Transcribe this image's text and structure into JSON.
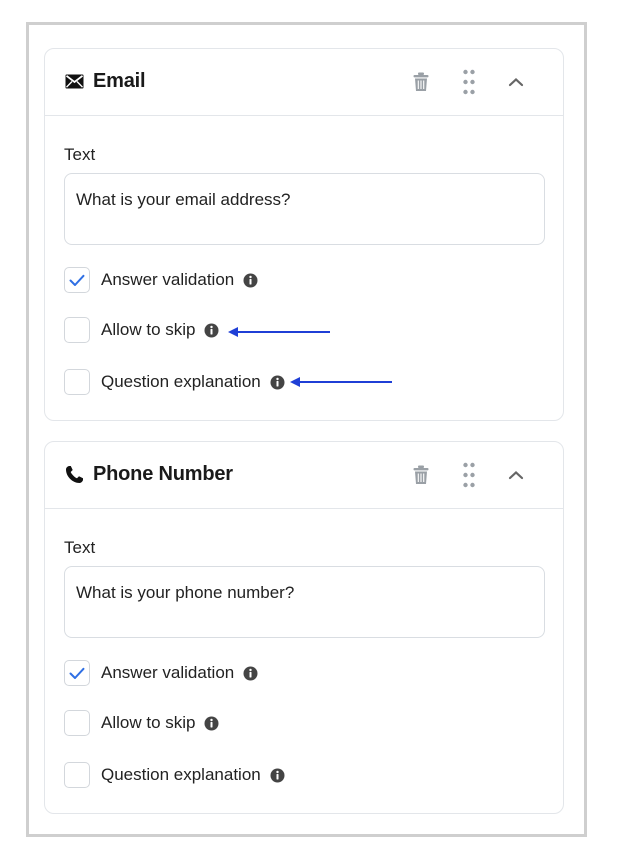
{
  "cards": [
    {
      "title": "Email",
      "icon": "envelope-icon",
      "field_label": "Text",
      "input_value": "What is your email address?",
      "options": [
        {
          "label": "Answer validation",
          "checked": true
        },
        {
          "label": "Allow to skip",
          "checked": false
        },
        {
          "label": "Question explanation",
          "checked": false
        }
      ]
    },
    {
      "title": "Phone Number",
      "icon": "phone-icon",
      "field_label": "Text",
      "input_value": "What is your phone number?",
      "options": [
        {
          "label": "Answer validation",
          "checked": true
        },
        {
          "label": "Allow to skip",
          "checked": false
        },
        {
          "label": "Question explanation",
          "checked": false
        }
      ]
    }
  ],
  "colors": {
    "checkmark": "#2f6fe4",
    "annotation_arrow": "#1f3fd6",
    "icon_gray": "#9aa0a6"
  }
}
